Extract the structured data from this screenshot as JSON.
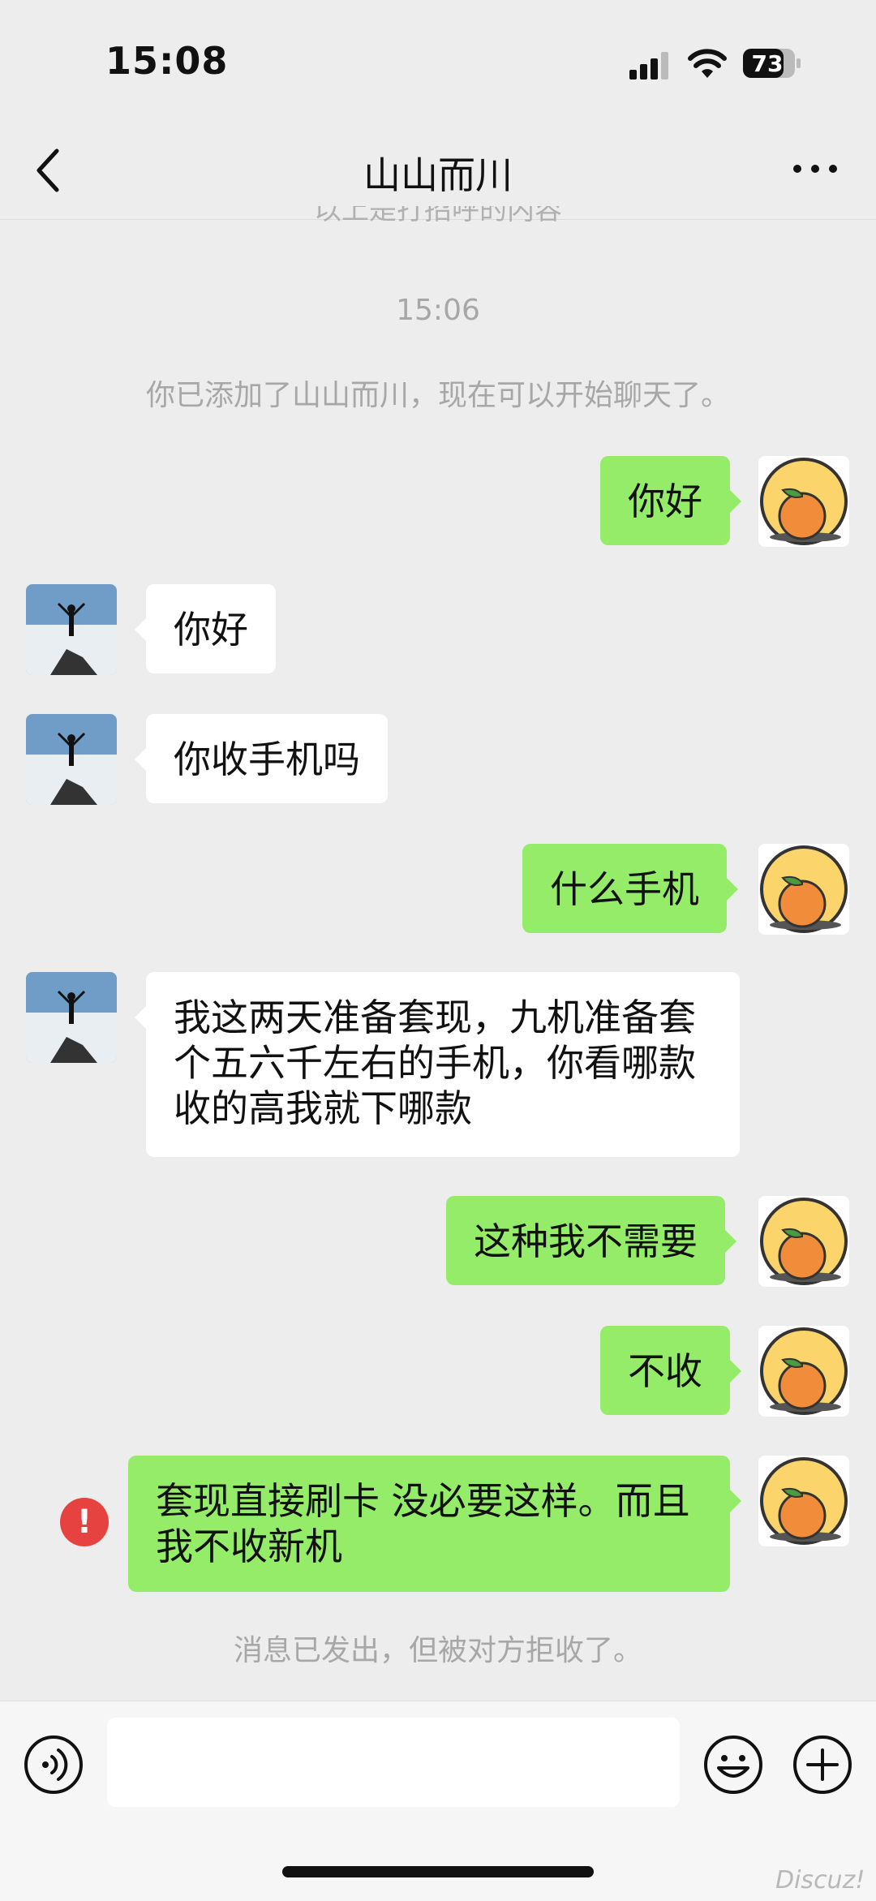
{
  "status_bar": {
    "time": "15:08",
    "battery": "73"
  },
  "nav": {
    "title": "山山而川"
  },
  "history_cut_text": "以上是打招呼的内容",
  "timestamp": "15:06",
  "system_added": "你已添加了山山而川，现在可以开始聊天了。",
  "messages": [
    {
      "from": "me",
      "text": "你好"
    },
    {
      "from": "other",
      "text": "你好"
    },
    {
      "from": "other",
      "text": "你收手机吗"
    },
    {
      "from": "me",
      "text": "什么手机"
    },
    {
      "from": "other",
      "text": "我这两天准备套现，九机准备套个五六千左右的手机，你看哪款收的高我就下哪款"
    },
    {
      "from": "me",
      "text": "这种我不需要"
    },
    {
      "from": "me",
      "text": "不收"
    },
    {
      "from": "me",
      "text": "套现直接刷卡 没必要这样。而且我不收新机",
      "status": "rejected"
    }
  ],
  "error_mark": "!",
  "system_rejected": "消息已发出，但被对方拒收了。",
  "watermark": "Discuz!",
  "icons": [
    "back-icon",
    "more-icon",
    "voice-icon",
    "emoji-icon",
    "plus-icon",
    "error-icon"
  ],
  "colors": {
    "me_bubble": "#95ec69",
    "other_bubble": "#ffffff",
    "background": "#ededed",
    "error": "#e64340"
  }
}
